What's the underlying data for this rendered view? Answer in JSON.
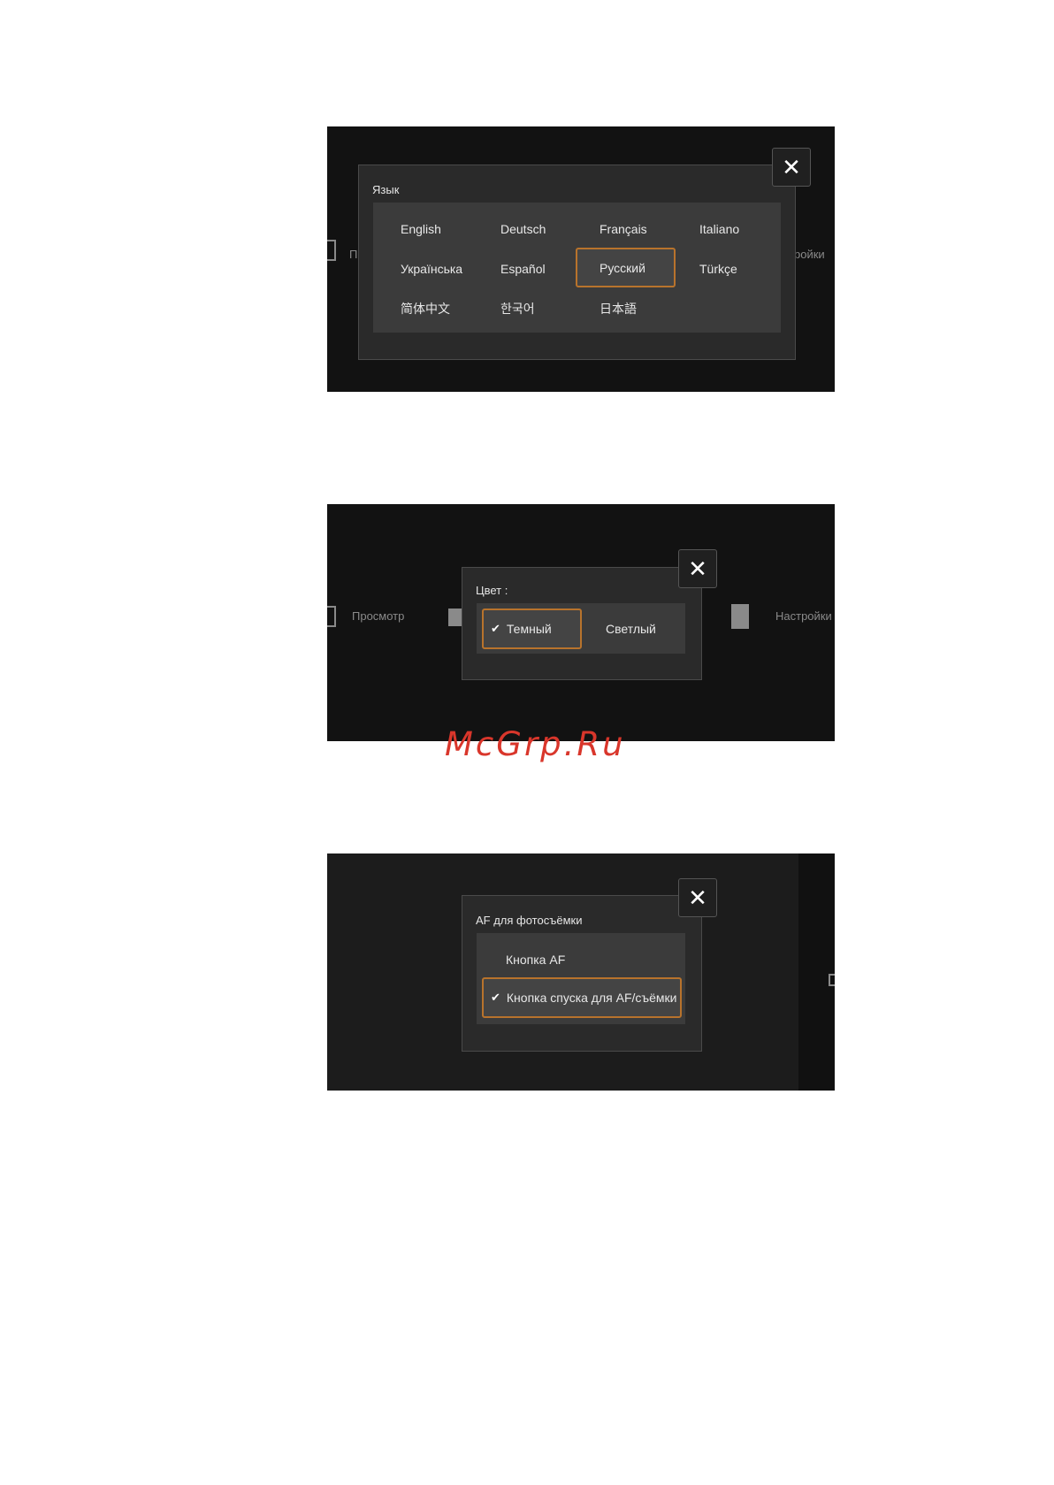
{
  "language_screen": {
    "title": "Язык",
    "bg_left_text": "П",
    "bg_right_text": "ройки",
    "options": [
      "English",
      "Deutsch",
      "Français",
      "Italiano",
      "Українська",
      "Español",
      "Русский",
      "Türkçe",
      "简体中文",
      "한국어",
      "日本語"
    ],
    "selected": "Русский",
    "close_glyph": "✕"
  },
  "color_screen": {
    "title": "Цвет :",
    "bg_left_text": "Просмотр",
    "bg_right_text": "Настройки",
    "options": [
      "Темный",
      "Светлый"
    ],
    "selected": "Темный",
    "check_glyph": "✔",
    "close_glyph": "✕"
  },
  "af_screen": {
    "title": "AF для фотосъёмки",
    "options": [
      "Кнопка AF",
      "Кнопка спуска для AF/съёмки"
    ],
    "selected": "Кнопка спуска для AF/съёмки",
    "check_glyph": "✔",
    "close_glyph": "✕"
  },
  "watermark": "McGrp.Ru"
}
